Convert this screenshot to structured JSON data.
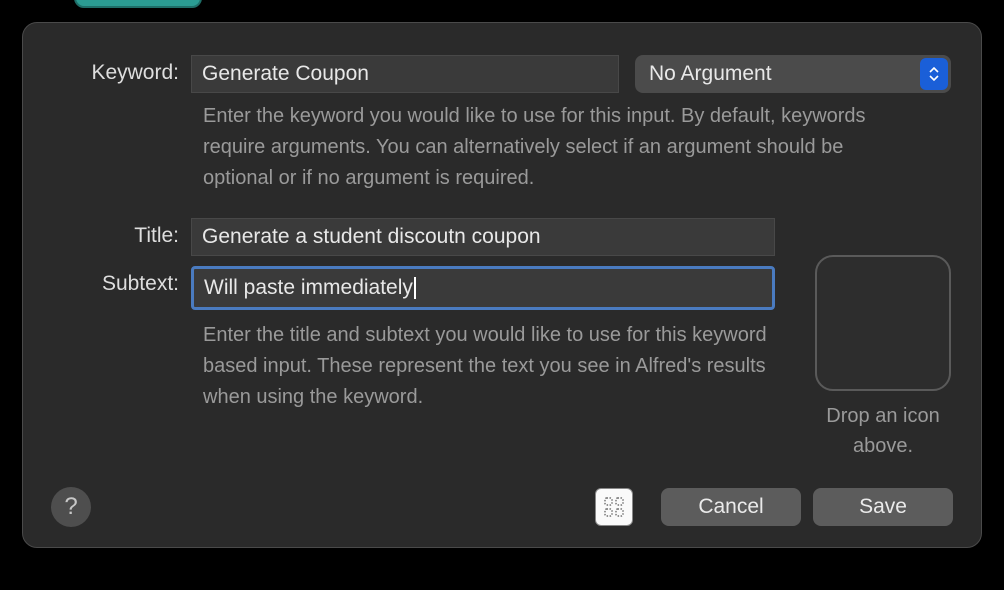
{
  "keyword": {
    "label": "Keyword:",
    "value": "Generate Coupon",
    "help": "Enter the keyword you would like to use for this input. By default, keywords require arguments. You can alternatively select if an argument should be optional or if no argument is required."
  },
  "argument": {
    "selected": "No Argument"
  },
  "title": {
    "label": "Title:",
    "value": "Generate a student discoutn coupon"
  },
  "subtext": {
    "label": "Subtext:",
    "value": "Will paste immediately",
    "help": "Enter the title and subtext you would like to use for this keyword based input. These represent the text you see in Alfred's results when using the keyword."
  },
  "icon_well": {
    "label": "Drop an icon above."
  },
  "footer": {
    "help_tooltip": "?",
    "cancel": "Cancel",
    "save": "Save"
  }
}
